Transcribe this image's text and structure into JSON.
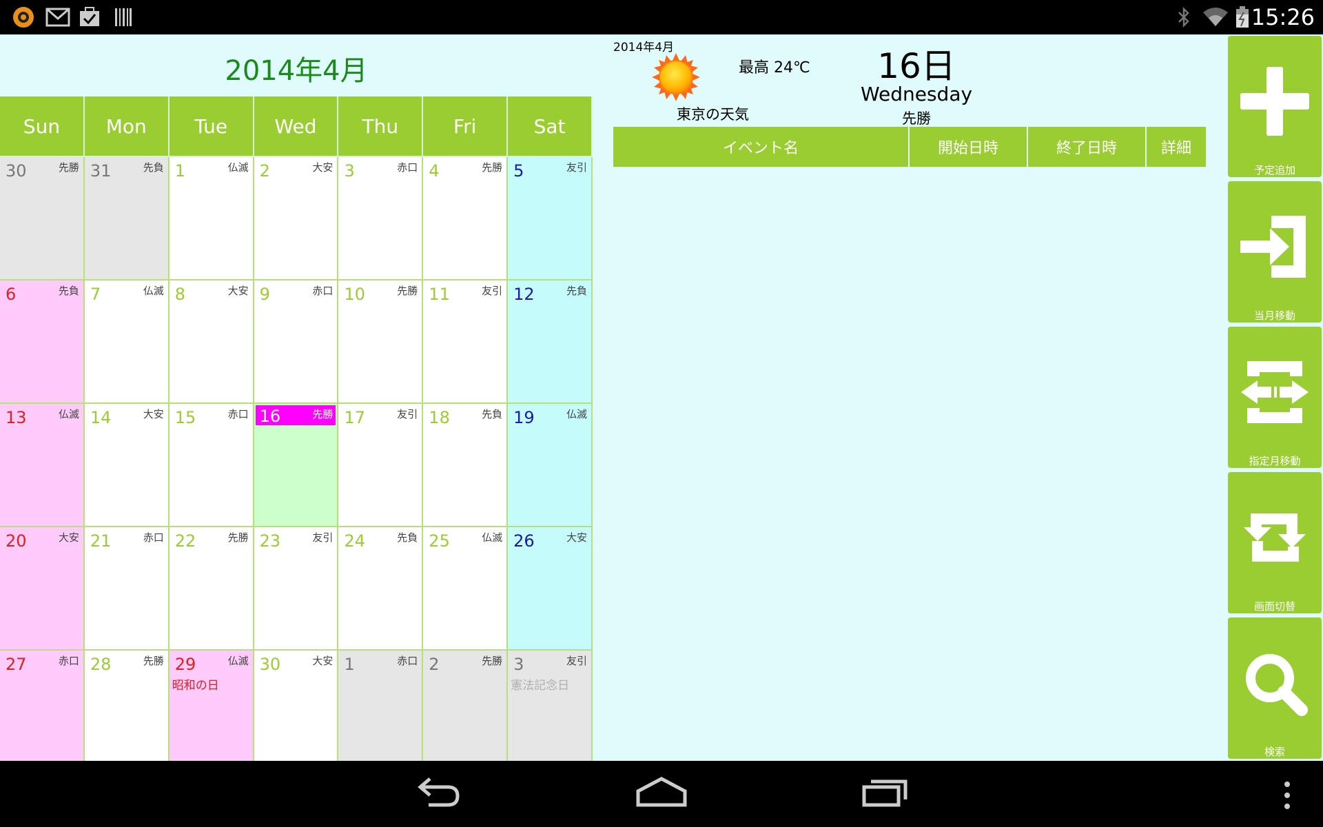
{
  "status_bar": {
    "clock": "15:26",
    "left_icons": [
      "app-logo-icon",
      "gmail-icon",
      "tasks-icon",
      "barcode-icon"
    ],
    "right_icons": [
      "bluetooth-icon",
      "wifi-icon",
      "battery-icon"
    ]
  },
  "calendar": {
    "title": "2014年4月",
    "weekdays": [
      "Sun",
      "Mon",
      "Tue",
      "Wed",
      "Thu",
      "Fri",
      "Sat"
    ],
    "weeks": [
      [
        {
          "day": "30",
          "rokuyo": "先勝",
          "type": "gray"
        },
        {
          "day": "31",
          "rokuyo": "先負",
          "type": "gray"
        },
        {
          "day": "1",
          "rokuyo": "仏滅",
          "type": "normal"
        },
        {
          "day": "2",
          "rokuyo": "大安",
          "type": "normal"
        },
        {
          "day": "3",
          "rokuyo": "赤口",
          "type": "normal"
        },
        {
          "day": "4",
          "rokuyo": "先勝",
          "type": "normal"
        },
        {
          "day": "5",
          "rokuyo": "友引",
          "type": "sat"
        }
      ],
      [
        {
          "day": "6",
          "rokuyo": "先負",
          "type": "sun"
        },
        {
          "day": "7",
          "rokuyo": "仏滅",
          "type": "normal"
        },
        {
          "day": "8",
          "rokuyo": "大安",
          "type": "normal"
        },
        {
          "day": "9",
          "rokuyo": "赤口",
          "type": "normal"
        },
        {
          "day": "10",
          "rokuyo": "先勝",
          "type": "normal"
        },
        {
          "day": "11",
          "rokuyo": "友引",
          "type": "normal"
        },
        {
          "day": "12",
          "rokuyo": "先負",
          "type": "sat"
        }
      ],
      [
        {
          "day": "13",
          "rokuyo": "仏滅",
          "type": "sun"
        },
        {
          "day": "14",
          "rokuyo": "大安",
          "type": "normal"
        },
        {
          "day": "15",
          "rokuyo": "赤口",
          "type": "normal"
        },
        {
          "day": "16",
          "rokuyo": "先勝",
          "type": "today"
        },
        {
          "day": "17",
          "rokuyo": "友引",
          "type": "normal"
        },
        {
          "day": "18",
          "rokuyo": "先負",
          "type": "normal"
        },
        {
          "day": "19",
          "rokuyo": "仏滅",
          "type": "sat"
        }
      ],
      [
        {
          "day": "20",
          "rokuyo": "大安",
          "type": "sun"
        },
        {
          "day": "21",
          "rokuyo": "赤口",
          "type": "normal"
        },
        {
          "day": "22",
          "rokuyo": "先勝",
          "type": "normal"
        },
        {
          "day": "23",
          "rokuyo": "友引",
          "type": "normal"
        },
        {
          "day": "24",
          "rokuyo": "先負",
          "type": "normal"
        },
        {
          "day": "25",
          "rokuyo": "仏滅",
          "type": "normal"
        },
        {
          "day": "26",
          "rokuyo": "大安",
          "type": "sat"
        }
      ],
      [
        {
          "day": "27",
          "rokuyo": "赤口",
          "type": "sun"
        },
        {
          "day": "28",
          "rokuyo": "先勝",
          "type": "normal"
        },
        {
          "day": "29",
          "rokuyo": "仏滅",
          "type": "holiday",
          "holiday": "昭和の日"
        },
        {
          "day": "30",
          "rokuyo": "大安",
          "type": "normal"
        },
        {
          "day": "1",
          "rokuyo": "赤口",
          "type": "gray"
        },
        {
          "day": "2",
          "rokuyo": "先勝",
          "type": "gray"
        },
        {
          "day": "3",
          "rokuyo": "友引",
          "type": "gray",
          "holiday": "憲法記念日"
        }
      ]
    ]
  },
  "weather": {
    "month": "2014年4月",
    "icon": "sun-icon",
    "label": "東京の天気",
    "temp": "最高 24℃"
  },
  "selected_day": {
    "day": "16日",
    "weekday": "Wednesday",
    "rokuyo": "先勝"
  },
  "event_table": {
    "headers": [
      "イベント名",
      "開始日時",
      "終了日時",
      "詳細"
    ]
  },
  "side_buttons": [
    {
      "label": "予定追加",
      "icon": "plus-icon"
    },
    {
      "label": "当月移動",
      "icon": "move-current-month-icon"
    },
    {
      "label": "指定月移動",
      "icon": "move-specified-month-icon"
    },
    {
      "label": "画面切替",
      "icon": "switch-screen-icon"
    },
    {
      "label": "検索",
      "icon": "search-icon"
    }
  ],
  "colors": {
    "accent_green": "#9acd32",
    "title_green": "#1b8a1b",
    "today_magenta": "#ff00ff",
    "background": "#dffbfb"
  },
  "nav_bar": [
    "back-icon",
    "home-icon",
    "recents-icon",
    "menu-icon"
  ]
}
